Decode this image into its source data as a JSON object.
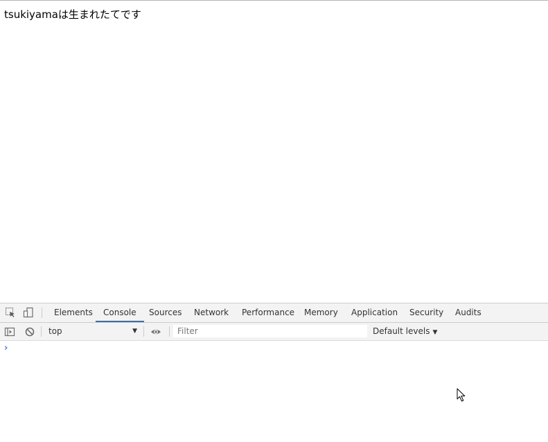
{
  "page": {
    "text": "tsukiyamaは生まれたてです"
  },
  "devtools": {
    "tabs": [
      {
        "label": "Elements"
      },
      {
        "label": "Console"
      },
      {
        "label": "Sources"
      },
      {
        "label": "Network"
      },
      {
        "label": "Performance"
      },
      {
        "label": "Memory"
      },
      {
        "label": "Application"
      },
      {
        "label": "Security"
      },
      {
        "label": "Audits"
      }
    ],
    "active_tab": "Console",
    "icons": {
      "inspect": "inspect-element-icon",
      "device": "device-toolbar-icon",
      "sidebar": "console-sidebar-icon",
      "clear": "clear-console-icon",
      "eye": "live-expression-icon",
      "cursor": "mouse-pointer-icon"
    },
    "toolbar": {
      "context": "top",
      "context_arrow": "▼",
      "filter_placeholder": "Filter",
      "levels_label": "Default levels",
      "levels_arrow": "▼"
    },
    "console": {
      "prompt": "›"
    },
    "colors": {
      "accent": "#1a73e8",
      "prompt": "#367cf1"
    }
  }
}
